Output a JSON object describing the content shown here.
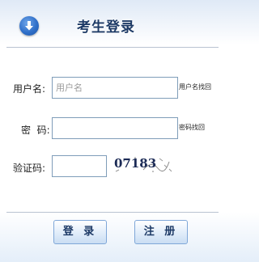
{
  "header": {
    "title": "考生登录",
    "icon": "arrow-down-circle-icon"
  },
  "form": {
    "username": {
      "label": "用户名:",
      "value": "",
      "placeholder": "用户名",
      "recover_link": "用户名找回"
    },
    "password": {
      "label": "密  码:",
      "value": "",
      "recover_link": "密码找回"
    },
    "captcha": {
      "label": "验证码:",
      "value": "",
      "image_text": "07183"
    }
  },
  "buttons": {
    "login": "登 录",
    "register": "注 册"
  },
  "colors": {
    "accent": "#2f6fc9",
    "title": "#1d3a66",
    "input_border": "#7f9db9"
  }
}
